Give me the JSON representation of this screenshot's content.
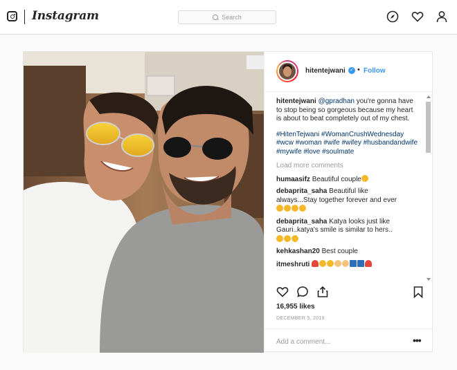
{
  "header": {
    "logo_icon": "instagram-camera-icon",
    "wordmark": "Instagram",
    "search_placeholder": "Search",
    "nav_icons": [
      "compass-icon",
      "heart-icon",
      "profile-icon"
    ]
  },
  "post": {
    "username": "hitentejwani",
    "verified": true,
    "separator": "•",
    "follow_label": "Follow",
    "caption": {
      "username": "hitentejwani",
      "mention": "@gpradhan",
      "text": " you're gonna have to stop being so gorgeous because my heart is about to beat completely out of my chest.",
      "hashtags": "#HitenTejwani #WomanCrushWednesday #wcw #woman #wife #wifey #husbandandwife #mywife #love #soulmate"
    },
    "load_more": "Load more comments",
    "comments": [
      {
        "user": "humaasifz",
        "text": "Beautiful couple",
        "emoji": [
          "heart-eyes"
        ]
      },
      {
        "user": "debaprita_saha",
        "text": "Beautiful like always...Stay together forever and ever",
        "emoji": [
          "heart-eyes",
          "heart-eyes",
          "heart-eyes",
          "kiss"
        ]
      },
      {
        "user": "debaprita_saha",
        "text": "Katya looks just like Gauri..katya's smile is similar to hers..",
        "emoji": [
          "heart-eyes",
          "heart-eyes",
          "kiss"
        ]
      },
      {
        "user": "kehkashan20",
        "text": "Best couple",
        "emoji": []
      },
      {
        "user": "itmeshruti",
        "text": "",
        "emoji": [
          "red-heart",
          "grin",
          "grin",
          "clap",
          "clap",
          "blue",
          "blue",
          "red-heart"
        ]
      }
    ],
    "likes": "16,955 likes",
    "date": "DECEMBER 5, 2018",
    "add_comment_placeholder": "Add a comment...",
    "more_label": "•••",
    "colors": {
      "link": "#003569",
      "follow": "#3897f0",
      "muted": "#999999",
      "verified": "#3897f0"
    }
  }
}
